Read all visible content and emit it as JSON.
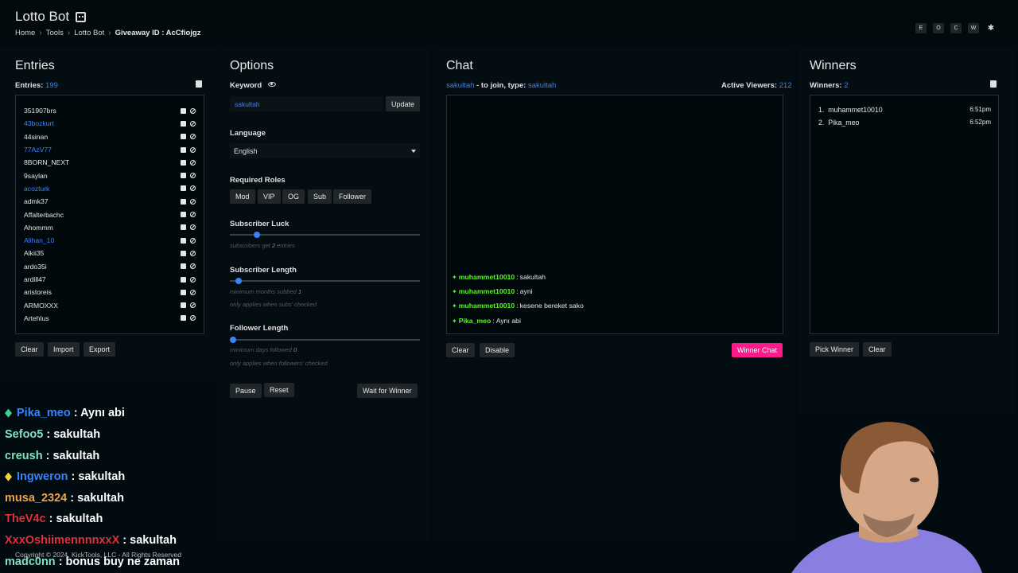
{
  "header": {
    "title": "Lotto Bot",
    "breadcrumb": [
      "Home",
      "Tools",
      "Lotto Bot"
    ],
    "breadcrumb_current": "Giveaway ID : AcCfiojgz",
    "top_buttons": [
      "E",
      "O",
      "C",
      "W",
      "✱"
    ]
  },
  "entries": {
    "title": "Entries",
    "count_label": "Entries:",
    "count": "199",
    "items": [
      {
        "name": "351907brs",
        "color": "#e6e6e6"
      },
      {
        "name": "43bozkurt",
        "color": "#3b82f6"
      },
      {
        "name": "44sinan",
        "color": "#e6e6e6"
      },
      {
        "name": "77AzV77",
        "color": "#3b82f6"
      },
      {
        "name": "8BORN_NEXT",
        "color": "#e6e6e6"
      },
      {
        "name": "9saylan",
        "color": "#e6e6e6"
      },
      {
        "name": "acozturk",
        "color": "#3b82f6"
      },
      {
        "name": "admk37",
        "color": "#e6e6e6"
      },
      {
        "name": "Affalterbachc",
        "color": "#e6e6e6"
      },
      {
        "name": "Ahommm",
        "color": "#e6e6e6"
      },
      {
        "name": "Alihan_10",
        "color": "#3b82f6"
      },
      {
        "name": "Alkii35",
        "color": "#e6e6e6"
      },
      {
        "name": "ardo35i",
        "color": "#e6e6e6"
      },
      {
        "name": "ardill47",
        "color": "#e6e6e6"
      },
      {
        "name": "aristoreis",
        "color": "#e6e6e6"
      },
      {
        "name": "ARMOXXX",
        "color": "#e6e6e6"
      },
      {
        "name": "Artehlus",
        "color": "#e6e6e6"
      }
    ],
    "buttons": {
      "clear": "Clear",
      "import": "Import",
      "export": "Export"
    }
  },
  "options": {
    "title": "Options",
    "keyword_label": "Keyword",
    "keyword_value": "sakultah",
    "update_label": "Update",
    "language_label": "Language",
    "language_value": "English",
    "roles_label": "Required Roles",
    "roles": [
      "Mod",
      "VIP",
      "OG",
      "Sub",
      "Follower"
    ],
    "sub_luck_label": "Subscriber Luck",
    "sub_luck_hint_pre": "subscribers get",
    "sub_luck_value": "2",
    "sub_luck_hint_post": "entries",
    "sub_luck_fraction": 0.125,
    "sub_length_label": "Subscriber Length",
    "sub_length_hint_pre": "minimum months subbed",
    "sub_length_value": "1",
    "sub_length_hint2": "only applies when subs' checked",
    "sub_length_fraction": 0.03,
    "follower_length_label": "Follower Length",
    "follower_length_hint_pre": "minimum days followed",
    "follower_length_value": "0",
    "follower_length_hint2": "only applies when followers' checked",
    "follower_length_fraction": 0.0,
    "pause_label": "Pause",
    "reset_label": "Reset",
    "wait_label": "Wait for Winner"
  },
  "chat": {
    "title": "Chat",
    "channel": "sakultah",
    "join_text": "- to join, type:",
    "join_keyword": "sakultah",
    "viewers_label": "Active Viewers:",
    "viewers": "212",
    "messages": [
      {
        "user": "muhammet10010",
        "text": "sakultah"
      },
      {
        "user": "muhammet10010",
        "text": "ayni"
      },
      {
        "user": "muhammet10010",
        "text": "kesene bereket sako"
      },
      {
        "user": "Pika_meo",
        "text": "Aynı abi"
      }
    ],
    "clear_label": "Clear",
    "disable_label": "Disable",
    "winner_chat_label": "Winner Chat"
  },
  "winners": {
    "title": "Winners",
    "count_label": "Winners:",
    "count": "2",
    "items": [
      {
        "rank": "1.",
        "name": "muhammet10010",
        "time": "6:51pm"
      },
      {
        "rank": "2.",
        "name": "Pika_meo",
        "time": "6:52pm"
      }
    ],
    "pick_label": "Pick Winner",
    "clear_label": "Clear"
  },
  "overlay_chat": [
    {
      "user": "Pika_meo",
      "text": ": Aynı abi",
      "color": "#3b82f6",
      "gem": "#3fd18f"
    },
    {
      "user": "Sefoo5",
      "text": ": sakultah",
      "color": "#7fe3c0",
      "gem": ""
    },
    {
      "user": "creush",
      "text": ": sakultah",
      "color": "#7fe3c0",
      "gem": ""
    },
    {
      "user": "Ingweron",
      "text": ": sakultah",
      "color": "#3b82f6",
      "gem": "#f5d33b"
    },
    {
      "user": "musa_2324",
      "text": ": sakultah",
      "color": "#f0a24a",
      "gem": ""
    },
    {
      "user": "TheV4c",
      "text": ": sakultah",
      "color": "#e0303a",
      "gem": ""
    },
    {
      "user": "XxxOshiimennnnxxX",
      "text": ": sakultah",
      "color": "#e0303a",
      "gem": ""
    },
    {
      "user": "madc0nn",
      "text": ": bonus buy ne zaman",
      "color": "#7fe3c0",
      "gem": ""
    }
  ],
  "footer": "Copyright © 2024, KickTools, LLC - All Rights Reserved"
}
